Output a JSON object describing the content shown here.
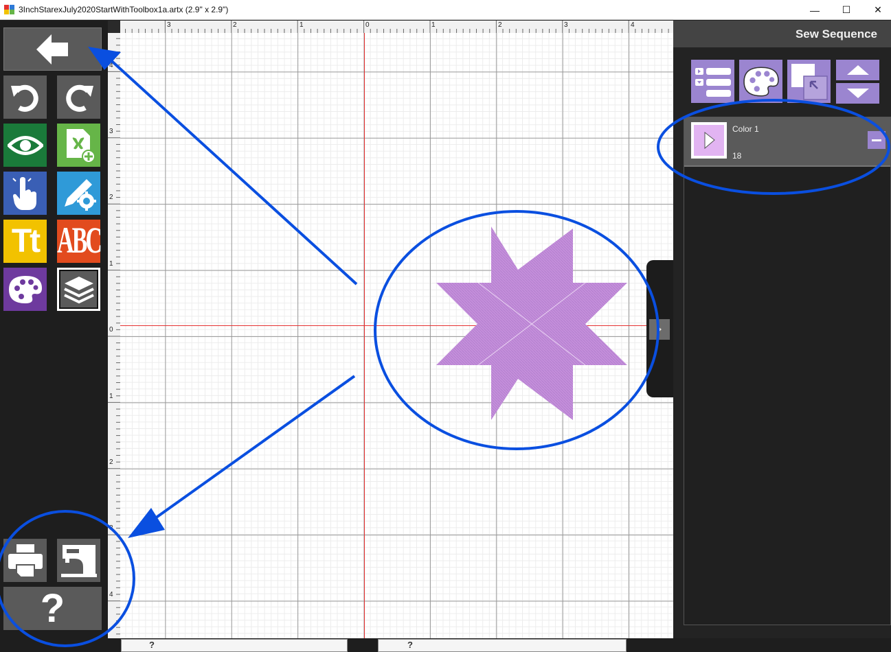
{
  "window": {
    "title": "3InchStarexJuly2020StartWithToolbox1a.artx (2.9\" x 2.9\")",
    "minimize_glyph": "—",
    "maximize_glyph": "☐",
    "close_glyph": "✕"
  },
  "toolbar": {
    "buttons": [
      {
        "name": "back-button",
        "icon": "left-arrow-icon",
        "color": "#5a5a5a"
      },
      {
        "name": "undo-button",
        "icon": "undo-icon",
        "color": "#5a5a5a"
      },
      {
        "name": "redo-button",
        "icon": "redo-icon",
        "color": "#5a5a5a"
      },
      {
        "name": "view-button",
        "icon": "eye-icon",
        "color": "#1a7a3a"
      },
      {
        "name": "new-design-button",
        "icon": "new-file-butterfly-icon",
        "color": "#66b548"
      },
      {
        "name": "select-button",
        "icon": "pointing-hand-icon",
        "color": "#3a5fb5"
      },
      {
        "name": "digitize-settings-button",
        "icon": "pencil-gear-icon",
        "color": "#2f9ad8"
      },
      {
        "name": "text-button",
        "icon": "text-tt-icon",
        "color": "#f2c200",
        "label": "Tt"
      },
      {
        "name": "monogram-button",
        "icon": "monogram-abc-icon",
        "color": "#e24b1e",
        "label": "ABC"
      },
      {
        "name": "color-palette-button",
        "icon": "palette-icon",
        "color": "#6e3a9e"
      },
      {
        "name": "layers-button",
        "icon": "layers-icon",
        "color": "#5a5a5a"
      },
      {
        "name": "print-button",
        "icon": "printer-icon",
        "color": "#5a5a5a"
      },
      {
        "name": "send-to-machine-button",
        "icon": "sewing-machine-icon",
        "color": "#5a5a5a"
      },
      {
        "name": "help-button",
        "icon": "question-icon",
        "color": "#5a5a5a",
        "label": "?"
      }
    ]
  },
  "canvas": {
    "ruler_top_labels": [
      "3",
      "2",
      "1",
      "0",
      "1",
      "2",
      "3",
      "4"
    ],
    "ruler_left_labels": [
      "4",
      "3",
      "2",
      "1",
      "0",
      "1",
      "2",
      "3",
      "4"
    ],
    "design": {
      "shape": "eight-point-star",
      "fill": "#c48fdb"
    }
  },
  "sew_sequence": {
    "title": "Sew Sequence",
    "toolbar_icons": [
      "list-view-icon",
      "palette-icon",
      "bring-to-front-icon",
      "move-up-icon",
      "move-down-icon"
    ],
    "items": [
      {
        "name": "Color 1",
        "stitch_count": "18",
        "swatch": "#e2b4f2"
      }
    ]
  },
  "bottom_strip": {
    "help_label_1": "?",
    "help_label_2": "?"
  },
  "annotations": {
    "color": "#0a4fe0"
  }
}
